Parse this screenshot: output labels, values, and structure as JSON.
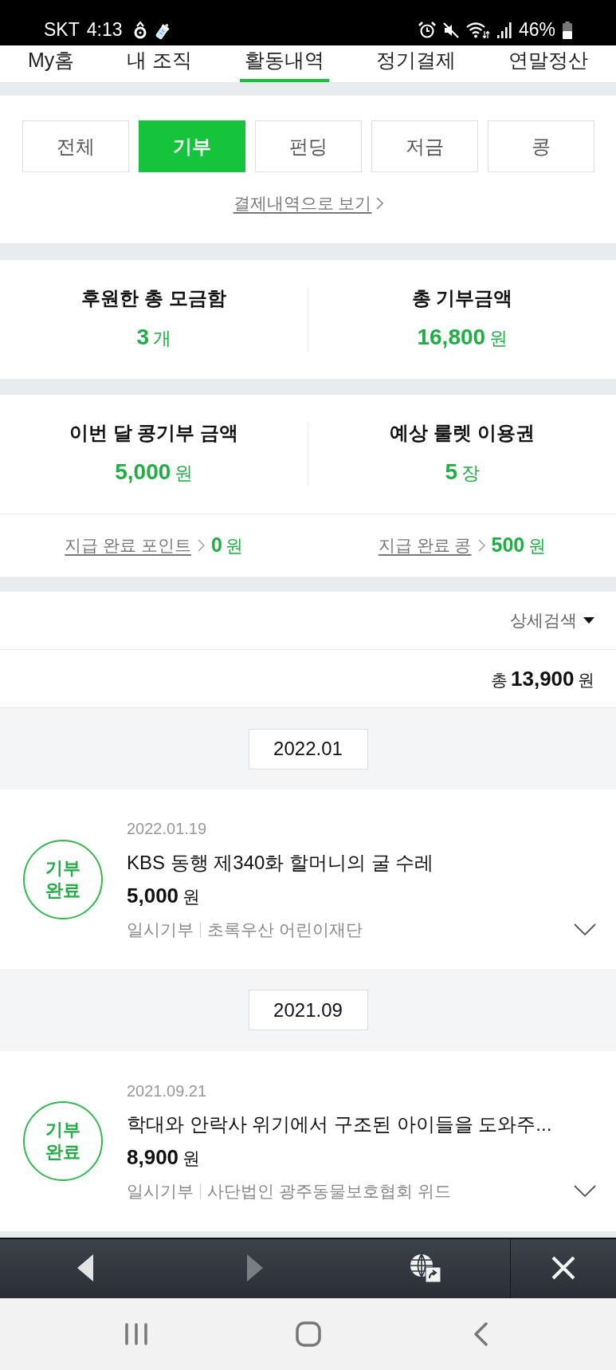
{
  "status_bar": {
    "carrier": "SKT",
    "time": "4:13",
    "battery": "46%"
  },
  "nav_tabs": [
    {
      "label": "My홈",
      "selected": false
    },
    {
      "label": "내 조직",
      "selected": false
    },
    {
      "label": "활동내역",
      "selected": true
    },
    {
      "label": "정기결제",
      "selected": false
    },
    {
      "label": "연말정산",
      "selected": false
    }
  ],
  "filter_tabs": [
    {
      "label": "전체",
      "selected": false
    },
    {
      "label": "기부",
      "selected": true
    },
    {
      "label": "펀딩",
      "selected": false
    },
    {
      "label": "저금",
      "selected": false
    },
    {
      "label": "콩",
      "selected": false
    }
  ],
  "payment_history_link": "결제내역으로 보기",
  "summary": [
    {
      "label": "후원한 총 모금함",
      "value": "3",
      "unit": "개"
    },
    {
      "label": "총 기부금액",
      "value": "16,800",
      "unit": "원"
    }
  ],
  "monthly": {
    "stats": [
      {
        "label": "이번 달 콩기부 금액",
        "value": "5,000",
        "unit": "원"
      },
      {
        "label": "예상 룰렛 이용권",
        "value": "5",
        "unit": "장"
      }
    ],
    "payouts": [
      {
        "label": "지급 완료 포인트",
        "value": "0",
        "unit": "원"
      },
      {
        "label": "지급 완료 콩",
        "value": "500",
        "unit": "원"
      }
    ]
  },
  "detail_search": "상세검색",
  "total": {
    "prefix": "총",
    "value": "13,900",
    "unit": "원"
  },
  "groups": [
    {
      "month": "2022.01",
      "items": [
        {
          "date": "2022.01.19",
          "status": "기부 완료",
          "title": "KBS 동행 제340화 할머니의 굴 수레",
          "amount": "5,000",
          "unit": "원",
          "type": "일시기부",
          "organization": "초록우산 어린이재단"
        }
      ]
    },
    {
      "month": "2021.09",
      "items": [
        {
          "date": "2021.09.21",
          "status": "기부 완료",
          "title": "학대와 안락사 위기에서 구조된 아이들을 도와주...",
          "amount": "8,900",
          "unit": "원",
          "type": "일시기부",
          "organization": "사단법인 광주동물보호협회 위드"
        }
      ]
    }
  ],
  "browser_toolbar": [
    {
      "kind": "back",
      "disabled": false
    },
    {
      "kind": "forward",
      "disabled": true
    },
    {
      "kind": "open_in_browser",
      "disabled": false
    },
    {
      "kind": "close",
      "disabled": false
    }
  ]
}
